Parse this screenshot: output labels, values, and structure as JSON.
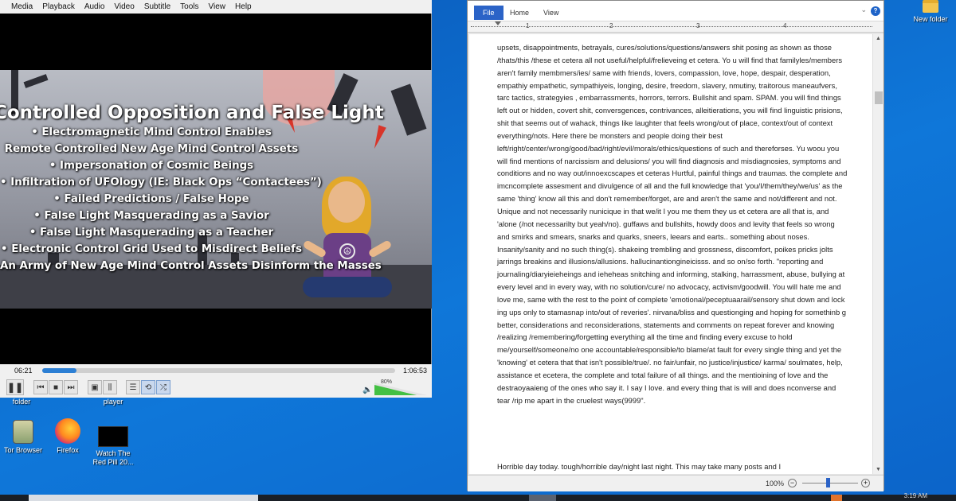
{
  "vlc": {
    "menu": [
      "Media",
      "Playback",
      "Audio",
      "Video",
      "Subtitle",
      "Tools",
      "View",
      "Help"
    ],
    "video": {
      "title": "Controlled Opposition and False Light",
      "bullets": [
        "• Electromagnetic Mind Control Enables",
        "Remote Controlled New Age Mind Control Assets",
        "• Impersonation of Cosmic Beings",
        "• Infiltration of UFOlogy (IE: Black Ops “Contactees”)",
        "• Failed Predictions / False Hope",
        "• False Light Masquerading as a Savior",
        "• False Light Masquerading as a Teacher",
        "• Electronic Control Grid Used to Misdirect Beliefs",
        "An Army of New Age Mind Control Assets Disinform the Masses"
      ]
    },
    "time_elapsed": "06:21",
    "time_total": "1:06:53",
    "progress_fraction": 0.096,
    "volume_label": "80%",
    "volume_fraction": 0.8
  },
  "desktop": {
    "icons": [
      {
        "label": "folder"
      },
      {
        "label": "player"
      },
      {
        "label": "Tor Browser"
      },
      {
        "label": "Firefox"
      },
      {
        "label": "Watch The Red Pill 20..."
      },
      {
        "label": "New folder"
      }
    ]
  },
  "word": {
    "tabs": {
      "file": "File",
      "home": "Home",
      "view": "View"
    },
    "help_label": "?",
    "ruler_numbers": [
      "1",
      "2",
      "3",
      "4",
      "5"
    ],
    "body_text": "upsets, disappointments, betrayals, cures/solutions/questions/answers shit posing as shown as those /thats/this /these et cetera all not useful/helpful/frelieveing et cetera. Yo u will find that familyles/members aren't family membmers/ies/ same with friends, lovers, compassion, love, hope, despair, desperation, empathiy empathetic, sympathiyeis, longing, desire, freedom, slavery, nmutiny, traitorous maneaufvers, tarc tactics, strategyies , embarrassments, horrors, terrors. Bullshit and spam. SPAM. you will find things left out or hidden, covert shit, conversgences, contrivances, alleitierations, you will find linguistic prisions, shit that seems out of wahack, things like laughter that feels wrong/out of place, context/out of context everything/nots. Here there be monsters and people doing their best left/right/center/wrong/good/bad/right/evil/morals/ethics/questions of such and thereforses. Yu woou  you will find mentions of narcissism and delusions/ you will find diagnosis and misdiagnosies, symptoms and conditions and no way out/innoexcscapes et ceteras Hurtful, painful things and traumas. the complete and imcncomplete assesment and divulgence of all and the full knowledge that 'you/I/them/they/we/us' as the same 'thing' know all this and don't remember/forget, are and aren't the same and not/different and not. Unique and not necessarily nunicique in that we/it I you me them they us et cetera are all that is, and 'alone (/not necessarilty but yeah/no). guffaws and bullshits, howdy doos and levity that feels so wrong and smirks and smears, snarks and quarks, sneers, leears and earts.. something about noses. Insanity/sanity and no such thing(s). shakeing trembling and grossness, discomfort, poikes pricks jolts jarrings breakins and illusions/allusions. hallucinantiongineicisss. and so on/so forth. \"reporting and journaling/diaryieieheings and ieheheas snitching and informing, stalking, harrassment, abuse, bullying at every level and in every way, with no solution/cure/ no advocacy, activism/goodwill. You will hate me and love me, same with the rest to the point of complete 'emotional/peceptuaarail/sensory shut down and lock ing ups only to stamasnap into/out of reveries'. nirvana/bliss and questionging and hoping for somethinb g better, considerations and reconsiderations, statements and comments on repeat forever and knowing /realizing /remembering/forgetting everything all the time and finding every excuse to hold me/yourself/someone/no one accountable/responsible/to blame/at fault for every single thing and yet the 'knowing' et cetera that that isn't possible/true/. no fair/unfair, no justice/injustice/ karma/ soulmates, help, assistance et ecetera, the complete and total failure of all things. and the mentioining of love and the destraoyaaieng of the ones who say it. I say I love. and every thing that is will and does nconverse and tear /rip me apart in the cruelest ways(9999\".",
    "body_text_2": "Horrible day today. tough/horrible day/night last night. This may take many posts and I",
    "zoom_label": "100%",
    "zoom_minus": "−",
    "zoom_plus": "+"
  },
  "taskbar": {
    "clock": "3:19 AM"
  }
}
